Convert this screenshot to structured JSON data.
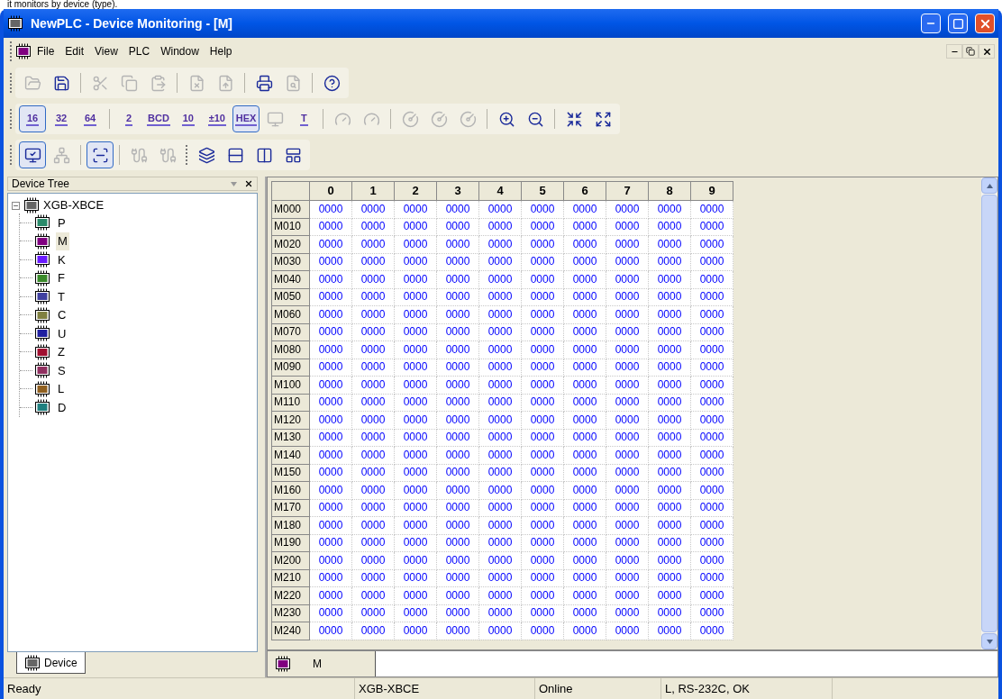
{
  "caption": "it monitors by device (type).",
  "window": {
    "title": "NewPLC - Device Monitoring - [M]"
  },
  "menu": [
    {
      "label": "File"
    },
    {
      "label": "Edit"
    },
    {
      "label": "View"
    },
    {
      "label": "PLC"
    },
    {
      "label": "Window"
    },
    {
      "label": "Help"
    }
  ],
  "toolbars": [
    [
      {
        "kind": "icon",
        "disabled": true,
        "selected": false
      },
      {
        "kind": "icon",
        "disabled": false,
        "selected": false
      },
      {
        "kind": "separator"
      },
      {
        "kind": "icon",
        "disabled": true,
        "selected": false
      },
      {
        "kind": "icon",
        "disabled": true,
        "selected": false
      },
      {
        "kind": "icon",
        "disabled": true,
        "selected": false
      },
      {
        "kind": "separator"
      },
      {
        "kind": "icon",
        "disabled": true,
        "selected": false
      },
      {
        "kind": "icon",
        "disabled": true,
        "selected": false
      },
      {
        "kind": "separator"
      },
      {
        "kind": "icon",
        "disabled": false,
        "selected": false
      },
      {
        "kind": "icon",
        "disabled": true,
        "selected": false
      },
      {
        "kind": "separator"
      },
      {
        "kind": "icon",
        "disabled": false,
        "selected": false
      }
    ],
    [
      {
        "kind": "text",
        "label": "16",
        "disabled": false,
        "selected": true
      },
      {
        "kind": "text",
        "label": "32",
        "disabled": false,
        "selected": false
      },
      {
        "kind": "text",
        "label": "64",
        "disabled": false,
        "selected": false
      },
      {
        "kind": "separator"
      },
      {
        "kind": "text",
        "label": "2",
        "disabled": false,
        "selected": false
      },
      {
        "kind": "text",
        "label": "BCD",
        "disabled": false,
        "selected": false
      },
      {
        "kind": "text",
        "label": "10",
        "disabled": false,
        "selected": false
      },
      {
        "kind": "text",
        "label": "±10",
        "disabled": false,
        "selected": false
      },
      {
        "kind": "text",
        "label": "HEX",
        "disabled": false,
        "selected": true
      },
      {
        "kind": "icon",
        "disabled": true,
        "selected": false
      },
      {
        "kind": "text",
        "label": "T",
        "disabled": false,
        "selected": false
      },
      {
        "kind": "separator"
      },
      {
        "kind": "icon",
        "disabled": true,
        "selected": false
      },
      {
        "kind": "icon",
        "disabled": true,
        "selected": false
      },
      {
        "kind": "separator"
      },
      {
        "kind": "icon",
        "disabled": true,
        "selected": false
      },
      {
        "kind": "icon",
        "disabled": true,
        "selected": false
      },
      {
        "kind": "icon",
        "disabled": true,
        "selected": false
      },
      {
        "kind": "separator"
      },
      {
        "kind": "icon",
        "disabled": false,
        "selected": false
      },
      {
        "kind": "icon",
        "disabled": false,
        "selected": false
      },
      {
        "kind": "separator"
      },
      {
        "kind": "icon",
        "disabled": false,
        "selected": false
      },
      {
        "kind": "icon",
        "disabled": false,
        "selected": false
      }
    ],
    [
      {
        "kind": "icon",
        "disabled": false,
        "selected": true
      },
      {
        "kind": "icon",
        "disabled": true,
        "selected": false
      },
      {
        "kind": "separator"
      },
      {
        "kind": "icon",
        "disabled": false,
        "selected": true
      },
      {
        "kind": "separator"
      },
      {
        "kind": "icon",
        "disabled": true,
        "selected": false
      },
      {
        "kind": "icon",
        "disabled": true,
        "selected": false
      },
      {
        "kind": "grip"
      },
      {
        "kind": "icon",
        "disabled": false,
        "selected": false
      },
      {
        "kind": "icon",
        "disabled": false,
        "selected": false
      },
      {
        "kind": "icon",
        "disabled": false,
        "selected": false
      },
      {
        "kind": "icon",
        "disabled": false,
        "selected": false
      }
    ]
  ],
  "device_tree": {
    "title": "Device Tree",
    "root": {
      "label": "XGB-XBCE",
      "expanded": true,
      "children": [
        {
          "label": "P",
          "color": "#2a8a6a",
          "selected": false
        },
        {
          "label": "M",
          "color": "#800080",
          "selected": true
        },
        {
          "label": "K",
          "color": "#6a1aff",
          "selected": false
        },
        {
          "label": "F",
          "color": "#3a8a2a",
          "selected": false
        },
        {
          "label": "T",
          "color": "#4040a0",
          "selected": false
        },
        {
          "label": "C",
          "color": "#808040",
          "selected": false
        },
        {
          "label": "U",
          "color": "#2020a0",
          "selected": false
        },
        {
          "label": "Z",
          "color": "#a01030",
          "selected": false
        },
        {
          "label": "S",
          "color": "#903060",
          "selected": false
        },
        {
          "label": "L",
          "color": "#906020",
          "selected": false
        },
        {
          "label": "D",
          "color": "#208080",
          "selected": false
        }
      ]
    },
    "tabs": [
      {
        "label": "Device",
        "selected": true
      }
    ]
  },
  "table": {
    "columns": [
      "0",
      "1",
      "2",
      "3",
      "4",
      "5",
      "6",
      "7",
      "8",
      "9"
    ],
    "rows": [
      {
        "label": "M000",
        "values": [
          "0000",
          "0000",
          "0000",
          "0000",
          "0000",
          "0000",
          "0000",
          "0000",
          "0000",
          "0000"
        ]
      },
      {
        "label": "M010",
        "values": [
          "0000",
          "0000",
          "0000",
          "0000",
          "0000",
          "0000",
          "0000",
          "0000",
          "0000",
          "0000"
        ]
      },
      {
        "label": "M020",
        "values": [
          "0000",
          "0000",
          "0000",
          "0000",
          "0000",
          "0000",
          "0000",
          "0000",
          "0000",
          "0000"
        ]
      },
      {
        "label": "M030",
        "values": [
          "0000",
          "0000",
          "0000",
          "0000",
          "0000",
          "0000",
          "0000",
          "0000",
          "0000",
          "0000"
        ]
      },
      {
        "label": "M040",
        "values": [
          "0000",
          "0000",
          "0000",
          "0000",
          "0000",
          "0000",
          "0000",
          "0000",
          "0000",
          "0000"
        ]
      },
      {
        "label": "M050",
        "values": [
          "0000",
          "0000",
          "0000",
          "0000",
          "0000",
          "0000",
          "0000",
          "0000",
          "0000",
          "0000"
        ]
      },
      {
        "label": "M060",
        "values": [
          "0000",
          "0000",
          "0000",
          "0000",
          "0000",
          "0000",
          "0000",
          "0000",
          "0000",
          "0000"
        ]
      },
      {
        "label": "M070",
        "values": [
          "0000",
          "0000",
          "0000",
          "0000",
          "0000",
          "0000",
          "0000",
          "0000",
          "0000",
          "0000"
        ]
      },
      {
        "label": "M080",
        "values": [
          "0000",
          "0000",
          "0000",
          "0000",
          "0000",
          "0000",
          "0000",
          "0000",
          "0000",
          "0000"
        ]
      },
      {
        "label": "M090",
        "values": [
          "0000",
          "0000",
          "0000",
          "0000",
          "0000",
          "0000",
          "0000",
          "0000",
          "0000",
          "0000"
        ]
      },
      {
        "label": "M100",
        "values": [
          "0000",
          "0000",
          "0000",
          "0000",
          "0000",
          "0000",
          "0000",
          "0000",
          "0000",
          "0000"
        ]
      },
      {
        "label": "M110",
        "values": [
          "0000",
          "0000",
          "0000",
          "0000",
          "0000",
          "0000",
          "0000",
          "0000",
          "0000",
          "0000"
        ]
      },
      {
        "label": "M120",
        "values": [
          "0000",
          "0000",
          "0000",
          "0000",
          "0000",
          "0000",
          "0000",
          "0000",
          "0000",
          "0000"
        ]
      },
      {
        "label": "M130",
        "values": [
          "0000",
          "0000",
          "0000",
          "0000",
          "0000",
          "0000",
          "0000",
          "0000",
          "0000",
          "0000"
        ]
      },
      {
        "label": "M140",
        "values": [
          "0000",
          "0000",
          "0000",
          "0000",
          "0000",
          "0000",
          "0000",
          "0000",
          "0000",
          "0000"
        ]
      },
      {
        "label": "M150",
        "values": [
          "0000",
          "0000",
          "0000",
          "0000",
          "0000",
          "0000",
          "0000",
          "0000",
          "0000",
          "0000"
        ]
      },
      {
        "label": "M160",
        "values": [
          "0000",
          "0000",
          "0000",
          "0000",
          "0000",
          "0000",
          "0000",
          "0000",
          "0000",
          "0000"
        ]
      },
      {
        "label": "M170",
        "values": [
          "0000",
          "0000",
          "0000",
          "0000",
          "0000",
          "0000",
          "0000",
          "0000",
          "0000",
          "0000"
        ]
      },
      {
        "label": "M180",
        "values": [
          "0000",
          "0000",
          "0000",
          "0000",
          "0000",
          "0000",
          "0000",
          "0000",
          "0000",
          "0000"
        ]
      },
      {
        "label": "M190",
        "values": [
          "0000",
          "0000",
          "0000",
          "0000",
          "0000",
          "0000",
          "0000",
          "0000",
          "0000",
          "0000"
        ]
      },
      {
        "label": "M200",
        "values": [
          "0000",
          "0000",
          "0000",
          "0000",
          "0000",
          "0000",
          "0000",
          "0000",
          "0000",
          "0000"
        ]
      },
      {
        "label": "M210",
        "values": [
          "0000",
          "0000",
          "0000",
          "0000",
          "0000",
          "0000",
          "0000",
          "0000",
          "0000",
          "0000"
        ]
      },
      {
        "label": "M220",
        "values": [
          "0000",
          "0000",
          "0000",
          "0000",
          "0000",
          "0000",
          "0000",
          "0000",
          "0000",
          "0000"
        ]
      },
      {
        "label": "M230",
        "values": [
          "0000",
          "0000",
          "0000",
          "0000",
          "0000",
          "0000",
          "0000",
          "0000",
          "0000",
          "0000"
        ]
      },
      {
        "label": "M240",
        "values": [
          "0000",
          "0000",
          "0000",
          "0000",
          "0000",
          "0000",
          "0000",
          "0000",
          "0000",
          "0000"
        ]
      }
    ]
  },
  "sheet_tabs": [
    {
      "label": "M",
      "selected": true
    }
  ],
  "status_bar": [
    "Ready",
    "XGB-XBCE",
    "Online",
    "L, RS-232C, OK"
  ]
}
